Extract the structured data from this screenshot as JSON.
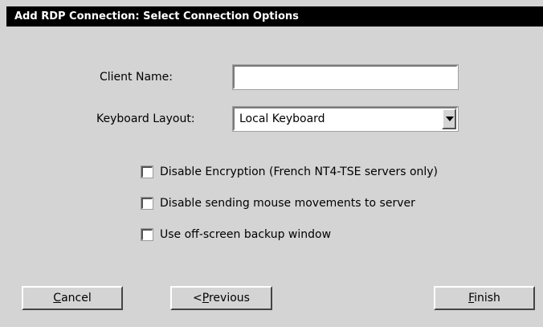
{
  "window": {
    "title": "Add RDP Connection: Select Connection Options"
  },
  "form": {
    "client_name": {
      "label": "Client Name:",
      "value": ""
    },
    "keyboard_layout": {
      "label": "Keyboard Layout:",
      "selected": "Local Keyboard"
    }
  },
  "options": [
    {
      "label": "Disable Encryption (French NT4-TSE servers only)",
      "checked": false
    },
    {
      "label": "Disable sending mouse movements to server",
      "checked": false
    },
    {
      "label": "Use off-screen backup window",
      "checked": false
    }
  ],
  "buttons": {
    "cancel": {
      "mnemonic": "C",
      "rest": "ancel"
    },
    "previous": {
      "prefix": "<",
      "mnemonic": "P",
      "rest": "revious"
    },
    "finish": {
      "mnemonic": "F",
      "rest": "inish"
    }
  }
}
